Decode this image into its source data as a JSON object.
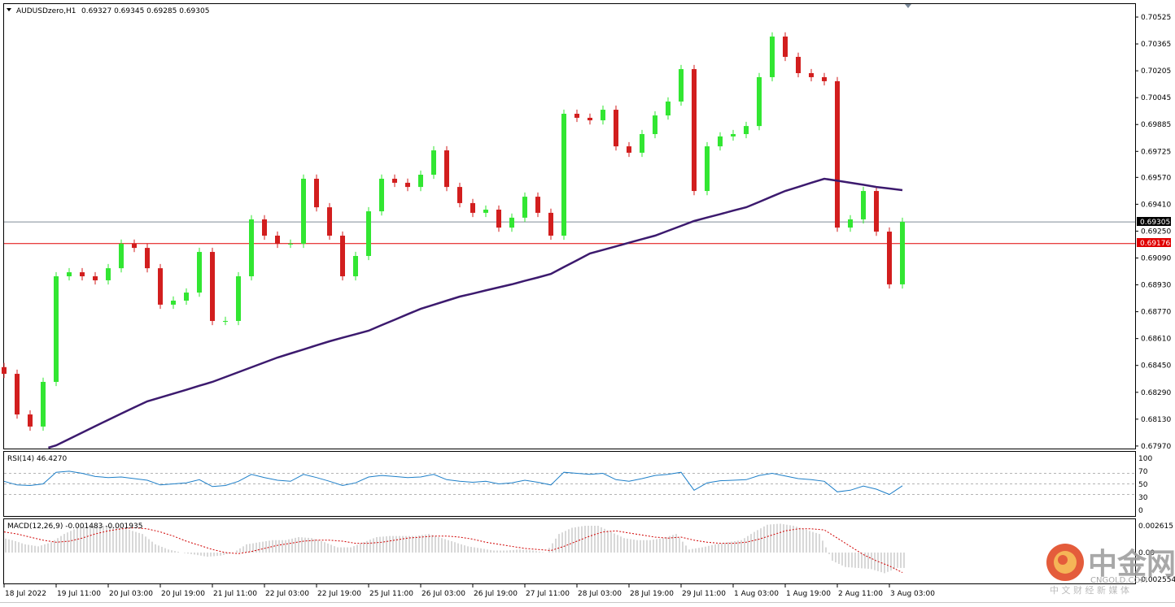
{
  "header": {
    "menu_icon": "triangle-down-icon",
    "symbol": "AUDUSDzero,H1",
    "ohlc": "0.69327 0.69345 0.69285 0.69305"
  },
  "price_lines": {
    "bid": {
      "value": "0.69305",
      "color": "#7f8c98",
      "label_bg": "#000000"
    },
    "level": {
      "value": "0.69176",
      "color": "#e00000",
      "label_bg": "#e00000"
    }
  },
  "rsi": {
    "label": "RSI(14) 46.4270",
    "ticks": [
      "100",
      "70",
      "50",
      "30",
      "0"
    ],
    "color": "#1e7fc8"
  },
  "macd": {
    "label": "MACD(12,26,9) -0.001483 -0.001935",
    "ticks": [
      "0.002615",
      "0.00",
      "-0.002554"
    ],
    "signal_color": "#d00000",
    "hist_color": "#b0b0b0"
  },
  "watermark": {
    "brand": "中金网",
    "domain": "CNGOLD.COM",
    "tagline": "中 文 财 经 新 媒 体"
  },
  "colors": {
    "bull": "#32e632",
    "bear": "#d21e1e",
    "ma": "#3c1a6e",
    "grid_border": "#000000"
  },
  "chart_data": [
    {
      "type": "candlestick",
      "title": "AUDUSDzero,H1",
      "timeframe": "H1",
      "sample_step_hours": 4,
      "price_ticks": [
        "0.70525",
        "0.70365",
        "0.70205",
        "0.70045",
        "0.69885",
        "0.69725",
        "0.69570",
        "0.69410",
        "0.69250",
        "0.69090",
        "0.68930",
        "0.68770",
        "0.68610",
        "0.68450",
        "0.68290",
        "0.68130",
        "0.67970"
      ],
      "ylim": [
        0.6797,
        0.7058
      ],
      "time_labels": [
        "18 Jul 2022",
        "19 Jul 11:00",
        "20 Jul 03:00",
        "20 Jul 19:00",
        "21 Jul 11:00",
        "22 Jul 03:00",
        "22 Jul 19:00",
        "25 Jul 11:00",
        "26 Jul 03:00",
        "26 Jul 19:00",
        "27 Jul 11:00",
        "28 Jul 03:00",
        "28 Jul 19:00",
        "29 Jul 11:00",
        "1 Aug 03:00",
        "1 Aug 19:00",
        "2 Aug 11:00",
        "3 Aug 03:00"
      ],
      "close": [
        0.684,
        0.68158,
        0.68086,
        0.68352,
        0.68981,
        0.69005,
        0.68981,
        0.68957,
        0.69029,
        0.69175,
        0.6915,
        0.69029,
        0.68812,
        0.68836,
        0.68884,
        0.69126,
        0.68715,
        0.68715,
        0.68981,
        0.6932,
        0.69223,
        0.69175,
        0.69175,
        0.69562,
        0.69392,
        0.69223,
        0.68981,
        0.69102,
        0.69368,
        0.69562,
        0.69538,
        0.69513,
        0.69586,
        0.69731,
        0.69513,
        0.69417,
        0.69359,
        0.69378,
        0.69271,
        0.6933,
        0.69455,
        0.69359,
        0.69223,
        0.69949,
        0.69925,
        0.6991,
        0.69973,
        0.69755,
        0.69717,
        0.69828,
        0.69939,
        0.70022,
        0.70215,
        0.69489,
        0.69755,
        0.69814,
        0.69828,
        0.69876,
        0.70167,
        0.70409,
        0.70288,
        0.70191,
        0.70167,
        0.70143,
        0.69271,
        0.6932,
        0.69489,
        0.69247,
        0.68933,
        0.69305
      ],
      "ma200": [
        null,
        null,
        null,
        null,
        0.67974,
        0.68012,
        0.6805,
        0.68088,
        0.68126,
        0.68163,
        0.682,
        0.68236,
        0.68259,
        0.68282,
        0.68305,
        0.68329,
        0.68352,
        0.68381,
        0.6841,
        0.68439,
        0.68468,
        0.68497,
        0.68521,
        0.68545,
        0.6857,
        0.68594,
        0.68615,
        0.68636,
        0.68657,
        0.6869,
        0.68722,
        0.68755,
        0.68787,
        0.68811,
        0.68836,
        0.6886,
        0.68878,
        0.68897,
        0.68915,
        0.68933,
        0.68954,
        0.68974,
        0.68995,
        0.69036,
        0.69076,
        0.69117,
        0.69138,
        0.69159,
        0.69181,
        0.69202,
        0.69223,
        0.69252,
        0.69281,
        0.6931,
        0.69331,
        0.69351,
        0.69372,
        0.69392,
        0.69424,
        0.69457,
        0.69489,
        0.69513,
        0.69538,
        0.69562,
        0.6955,
        0.69538,
        0.69526,
        0.69513,
        0.69504,
        0.69494
      ]
    },
    {
      "type": "line",
      "title": "RSI(14)",
      "ylim": [
        0,
        100
      ],
      "levels": [
        70,
        50,
        30
      ],
      "values": [
        55,
        48,
        47,
        50,
        72,
        74,
        70,
        64,
        62,
        63,
        60,
        57,
        48,
        50,
        52,
        58,
        45,
        47,
        55,
        68,
        62,
        57,
        55,
        68,
        62,
        55,
        47,
        52,
        63,
        66,
        64,
        62,
        63,
        68,
        58,
        55,
        53,
        55,
        50,
        52,
        57,
        53,
        48,
        72,
        70,
        68,
        70,
        58,
        55,
        60,
        66,
        68,
        72,
        38,
        52,
        56,
        57,
        58,
        66,
        70,
        65,
        60,
        58,
        55,
        35,
        38,
        46,
        40,
        30,
        46.427
      ]
    },
    {
      "type": "bar",
      "title": "MACD(12,26,9)",
      "ylim": [
        -0.002554,
        0.002615
      ],
      "main": [
        0.0015,
        0.0012,
        0.0008,
        0.0006,
        0.001,
        0.0018,
        0.0024,
        0.0026,
        0.0026,
        0.0025,
        0.0022,
        0.0018,
        0.0008,
        0.0003,
        0.0,
        -0.0002,
        -0.0004,
        -0.0003,
        0.0,
        0.0008,
        0.001,
        0.0012,
        0.0012,
        0.0015,
        0.0014,
        0.001,
        0.0005,
        0.0005,
        0.001,
        0.0015,
        0.0016,
        0.0016,
        0.0016,
        0.0018,
        0.0014,
        0.001,
        0.0006,
        0.0004,
        0.0002,
        0.0002,
        0.0003,
        0.0002,
        0.0,
        0.0018,
        0.0024,
        0.0026,
        0.0026,
        0.002,
        0.0014,
        0.0012,
        0.0012,
        0.0014,
        0.0018,
        0.0003,
        0.0005,
        0.0008,
        0.001,
        0.0012,
        0.002,
        0.0027,
        0.0028,
        0.0026,
        0.0022,
        0.0018,
        -0.0008,
        -0.0014,
        -0.0015,
        -0.0016,
        -0.002,
        -0.001483
      ],
      "signal": [
        0.002,
        0.0018,
        0.0015,
        0.0012,
        0.001,
        0.0011,
        0.0014,
        0.0018,
        0.0021,
        0.0023,
        0.0024,
        0.0023,
        0.002,
        0.0016,
        0.0011,
        0.0007,
        0.0003,
        0.0,
        -0.0001,
        0.0001,
        0.0004,
        0.0007,
        0.0009,
        0.0011,
        0.0012,
        0.0012,
        0.0011,
        0.0009,
        0.0009,
        0.001,
        0.0012,
        0.0014,
        0.0015,
        0.0016,
        0.0016,
        0.0015,
        0.0013,
        0.001,
        0.0008,
        0.0006,
        0.0004,
        0.0003,
        0.0002,
        0.0006,
        0.0011,
        0.0016,
        0.002,
        0.0021,
        0.0019,
        0.0017,
        0.0015,
        0.0014,
        0.0015,
        0.0012,
        0.001,
        0.0009,
        0.0009,
        0.001,
        0.0013,
        0.0017,
        0.0021,
        0.0023,
        0.0023,
        0.0022,
        0.0014,
        0.0006,
        -0.0002,
        -0.0008,
        -0.0013,
        -0.001935
      ]
    }
  ]
}
